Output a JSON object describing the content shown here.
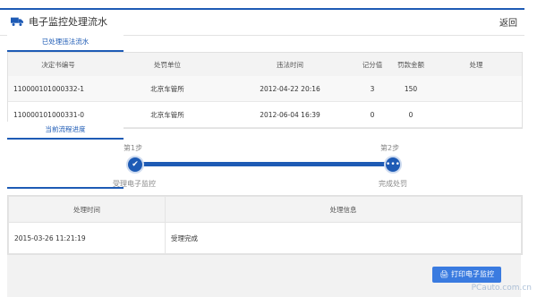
{
  "header": {
    "title": "电子监控处理流水",
    "back_label": "返回"
  },
  "violations_tab": "已处理违法流水",
  "violations_table": {
    "columns": [
      "决定书编号",
      "处罚单位",
      "违法时间",
      "记分值",
      "罚款金额",
      "处理"
    ],
    "rows": [
      {
        "id": "110000101000332-1",
        "unit": "北京车管所",
        "time": "2012-04-22 20:16",
        "points": "3",
        "fine": "150",
        "action": ""
      },
      {
        "id": "110000101000331-0",
        "unit": "北京车管所",
        "time": "2012-06-04 16:39",
        "points": "0",
        "fine": "0",
        "action": ""
      }
    ]
  },
  "progress_tab": "当前流程进度",
  "progress": {
    "step1_label": "第1步",
    "step2_label": "第2步",
    "step1_name": "受理电子监控",
    "step2_name": "完成处罚",
    "step1_icon": "check-icon",
    "step2_icon": "ellipsis-icon"
  },
  "history_table": {
    "columns": [
      "处理时间",
      "处理信息"
    ],
    "rows": [
      {
        "time": "2015-03-26 11:21:19",
        "info": "受理完成"
      }
    ]
  },
  "footer": {
    "print_label": "打印电子监控"
  },
  "watermark": "PCauto.com.cn",
  "colors": {
    "accent": "#1e5bb5",
    "button": "#3a7be0"
  }
}
